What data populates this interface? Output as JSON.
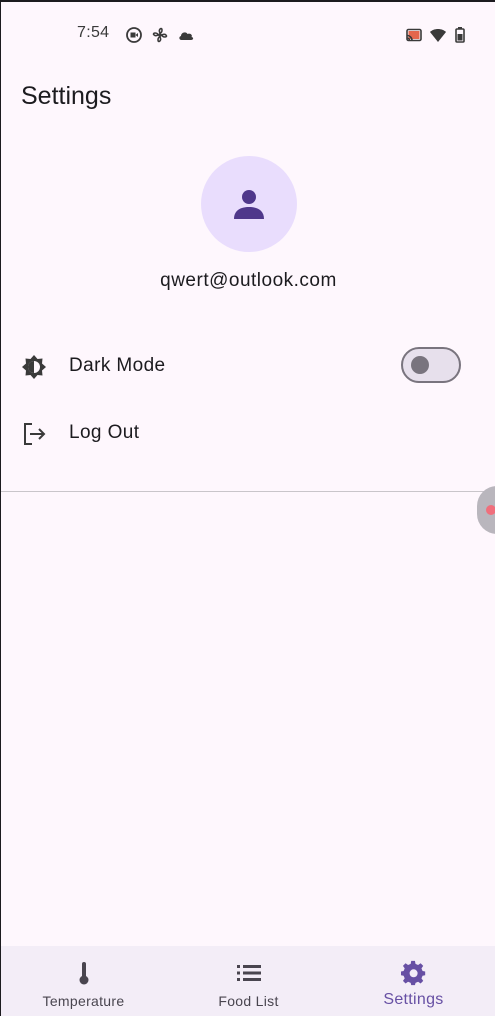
{
  "status_bar": {
    "time": "7:54",
    "left_icons": [
      "screen-record-icon",
      "fan-icon",
      "cloud-icon"
    ],
    "right_icons": [
      "cast-icon",
      "wifi-icon",
      "battery-icon"
    ]
  },
  "app_bar": {
    "title": "Settings"
  },
  "profile": {
    "avatar_icon": "person-icon",
    "email": "qwert@outlook.com"
  },
  "settings_list": {
    "dark_mode": {
      "label": "Dark Mode",
      "icon": "brightness-icon",
      "enabled": false
    },
    "log_out": {
      "label": "Log Out",
      "icon": "logout-icon"
    }
  },
  "bottom_nav": {
    "items": [
      {
        "label": "Temperature",
        "icon": "thermometer-icon",
        "active": false
      },
      {
        "label": "Food List",
        "icon": "list-icon",
        "active": false
      },
      {
        "label": "Settings",
        "icon": "gear-icon",
        "active": true
      }
    ]
  },
  "colors": {
    "background": "#fef7fd",
    "primary": "#6750a4",
    "avatar_bg": "#e9ddfd",
    "avatar_icon": "#4f378b",
    "on_surface": "#1c1b1f",
    "outline": "#79747e",
    "nav_bg": "#f3edf7"
  }
}
